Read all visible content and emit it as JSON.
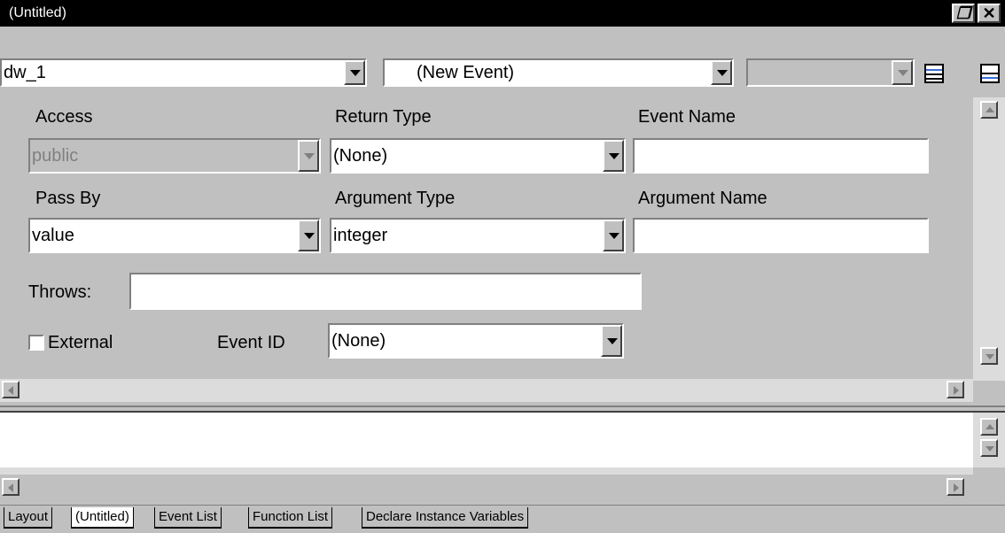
{
  "window": {
    "title": "(Untitled)",
    "restore_icon": "restore-icon",
    "close_icon": "close-icon"
  },
  "toolbar": {
    "object_select": "dw_1",
    "event_select": "(New Event)",
    "third_select": ""
  },
  "labels": {
    "access": "Access",
    "return_type": "Return Type",
    "event_name": "Event Name",
    "pass_by": "Pass By",
    "argument_type": "Argument Type",
    "argument_name": "Argument Name",
    "throws": "Throws:",
    "external": "External",
    "event_id": "Event ID"
  },
  "values": {
    "access": "public",
    "return_type": "(None)",
    "event_name": "",
    "pass_by": "value",
    "argument_type": "integer",
    "argument_name": "",
    "throws": "",
    "external_checked": false,
    "event_id": "(None)"
  },
  "tabs": [
    {
      "label": "Layout",
      "active": false
    },
    {
      "label": "(Untitled)",
      "active": true
    },
    {
      "label": "Event List",
      "active": false
    },
    {
      "label": "Function List",
      "active": false
    },
    {
      "label": "Declare Instance Variables",
      "active": false
    }
  ],
  "colors": {
    "face": "#c0c0c0",
    "titlebar": "#000000",
    "field": "#ffffff"
  }
}
